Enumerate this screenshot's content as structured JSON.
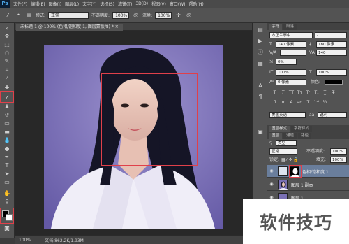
{
  "menu": {
    "logo": "Ps",
    "items": [
      "文件(F)",
      "编辑(E)",
      "图像(I)",
      "图层(L)",
      "文字(Y)",
      "选择(S)",
      "滤镜(T)",
      "3D(D)",
      "视图(V)",
      "窗口(W)",
      "帮助(H)"
    ]
  },
  "options": {
    "mode_label": "模式:",
    "mode_value": "正常",
    "opacity_label": "不透明度:",
    "opacity_value": "100%",
    "flow_label": "流量:",
    "flow_value": "100%"
  },
  "document": {
    "tab_title": "未标题-1 @ 100% (色相/饱和度 1, 图层蒙版/8) *",
    "zoom": "100%",
    "doc_size": "文档:862.2K/1.93M"
  },
  "character_panel": {
    "tabs": [
      "字符",
      "段落"
    ],
    "font_family": "方正兰亭中...",
    "font_style": "-",
    "font_size": "140 像素",
    "leading": "180 像素",
    "tracking": "140",
    "kerning": "0%",
    "vertical_scale": "100%",
    "horizontal_scale": "100%",
    "baseline_shift": "0 像素",
    "color_label": "颜色:",
    "language": "美国英语",
    "antialias": "锐利"
  },
  "layers_panel": {
    "top_tabs": [
      "图层样式",
      "字符样式"
    ],
    "tabs": [
      "图层",
      "通道",
      "路径"
    ],
    "kind_label": "类型",
    "blend_mode": "正常",
    "opacity_label": "不透明度:",
    "opacity_value": "100%",
    "lock_label": "锁定:",
    "fill_label": "填充:",
    "fill_value": "100%",
    "layers": [
      {
        "name": "色相/饱和度 1",
        "selected": true
      },
      {
        "name": "图层 1 副本",
        "selected": false
      },
      {
        "name": "图层 1",
        "selected": false
      }
    ]
  },
  "watermark": "软件技巧",
  "colors": {
    "accent_red": "#e0404a",
    "panel_bg": "#535353",
    "selected_layer": "#6a7e9c",
    "purple_background": "#7a70b4"
  }
}
